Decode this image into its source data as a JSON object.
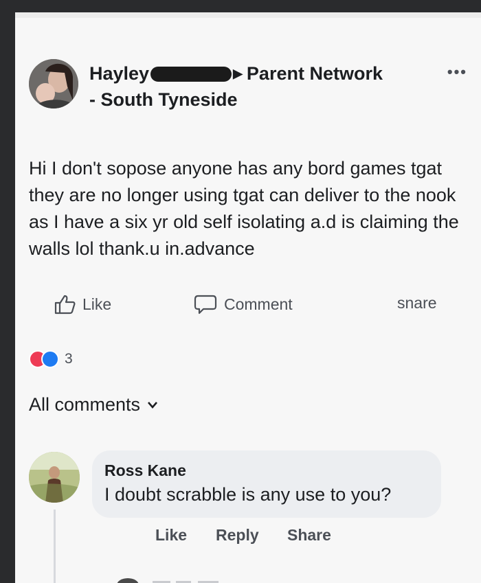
{
  "post": {
    "author_first": "Hayley",
    "group": "Parent Network",
    "group_line2": "- South Tyneside",
    "more_icon": "more-horizontal-icon",
    "text": "Hi I don't sopose anyone has any bord games tgat they are no longer using tgat can deliver to the nook as I have a six yr old self isolating a.d is claiming the walls lol  thank.u in.advance"
  },
  "actions": {
    "like": "Like",
    "comment": "Comment",
    "share": "snare"
  },
  "reactions": {
    "count": "3",
    "colors": {
      "love": "#ee3b55",
      "like": "#1e7bf2"
    }
  },
  "comments_filter": "All comments",
  "comment": {
    "author": "Ross Kane",
    "text": "I doubt scrabble is any use to you?",
    "like": "Like",
    "reply": "Reply",
    "share": "Share"
  }
}
